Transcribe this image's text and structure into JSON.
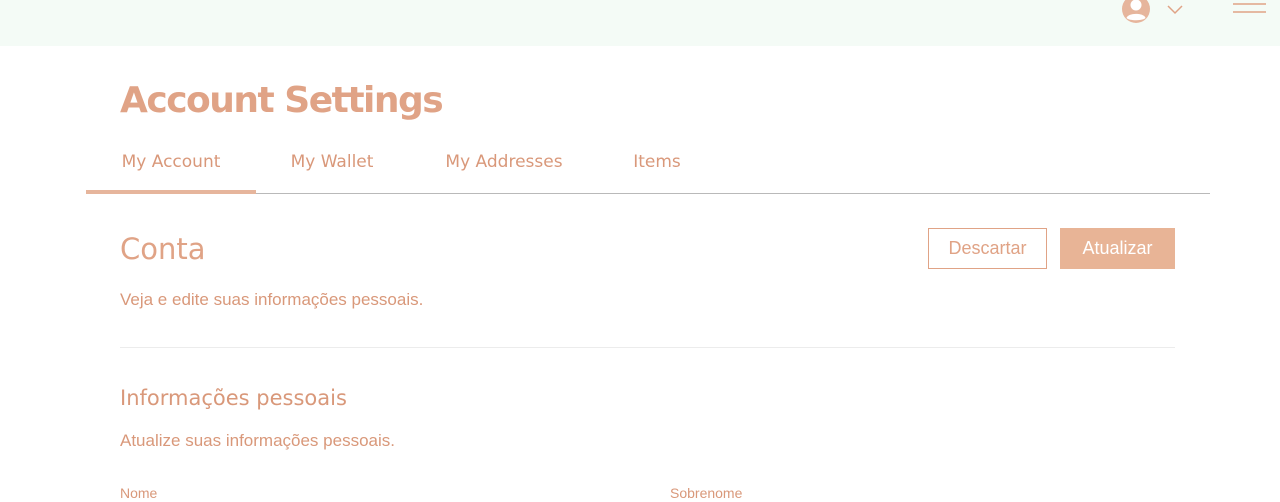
{
  "header": {
    "avatar_icon": "user-avatar-icon",
    "dropdown_icon": "chevron-down-icon",
    "menu_icon": "hamburger-menu-icon"
  },
  "page": {
    "title": "Account Settings"
  },
  "tabs": [
    {
      "label": "My Account",
      "active": true
    },
    {
      "label": "My Wallet",
      "active": false
    },
    {
      "label": "My Addresses",
      "active": false
    },
    {
      "label": "Items",
      "active": false
    }
  ],
  "account": {
    "title": "Conta",
    "description": "Veja e edite suas informações pessoais.",
    "discard_label": "Descartar",
    "update_label": "Atualizar"
  },
  "personal_info": {
    "title": "Informações pessoais",
    "description": "Atualize suas informações pessoais.",
    "first_field_label": "Nome",
    "second_field_label": "Sobrenome"
  },
  "colors": {
    "accent": "#e0a386",
    "button_fill": "#e8b496",
    "topbar_bg": "#f4fbf6"
  }
}
